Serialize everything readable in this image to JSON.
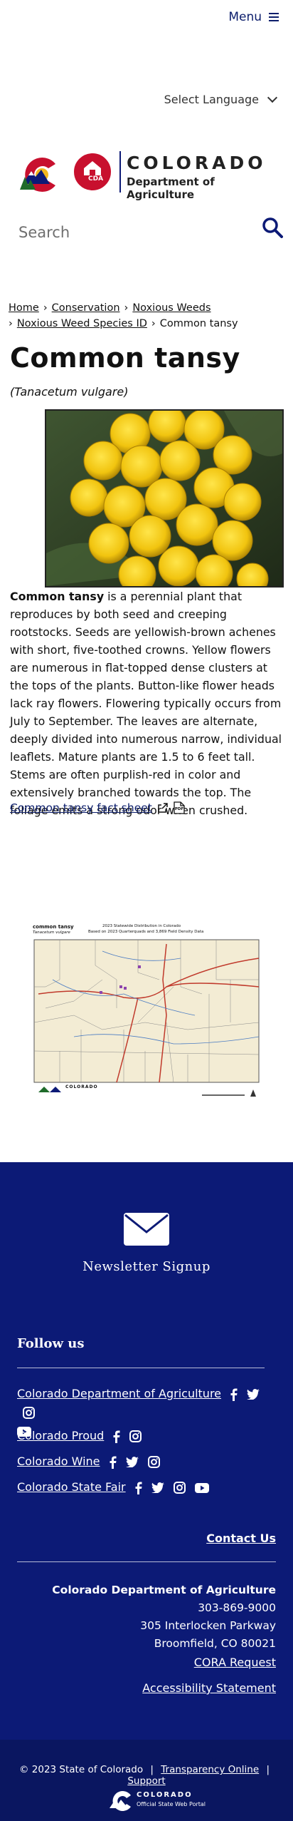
{
  "header": {
    "menu_label": "Menu",
    "language_label": "Select Language",
    "logo_line1": "COLORADO",
    "logo_line2": "Department of Agriculture",
    "logo_badge": "CDA",
    "search_placeholder": "Search"
  },
  "breadcrumb": {
    "items": [
      "Home",
      "Conservation",
      "Noxious Weeds",
      "Noxious Weed Species ID",
      "Common tansy"
    ],
    "separator": "›"
  },
  "page": {
    "title": "Common tansy",
    "scientific_name": "(Tanacetum vulgare)",
    "description_lead": "Common tansy",
    "description_rest": " is a perennial plant that reproduces by both seed and creeping rootstocks. Seeds are yellowish-brown achenes with short, five-toothed crowns. Yellow flowers are numerous in flat-topped dense clusters at the tops of the plants. Button-like flower heads lack ray flowers. Flowering typically occurs from July to September. The leaves are alternate, deeply divided into numerous narrow, individual leaflets. Mature plants are 1.5 to 6 feet tall. Stems are often purplish-red in color and extensively branched towards the top. The foliage emits a strong odor when crushed.",
    "fact_sheet_link": "Common tansy fact sheet",
    "pdf_icon_text": "PDF"
  },
  "map": {
    "title": "common tansy",
    "subtitle": "Tanacetum vulgare",
    "heading_line1": "2023 Statewide Distribution in Colorado",
    "heading_line2": "Based on 2023 Quarterquads and 3,869 Field Density Data",
    "logo_text": "COLORADO"
  },
  "footer": {
    "newsletter_label": "Newsletter Signup",
    "follow_heading": "Follow us",
    "social_rows": [
      "Colorado Department of Agriculture",
      "Colorado Proud",
      "Colorado Wine",
      "Colorado State Fair"
    ],
    "contact_label": "Contact Us",
    "org_name": "Colorado Department of Agriculture",
    "phone": "303-869-9000",
    "address1": "305 Interlocken Parkway",
    "address2": "Broomfield, CO 80021",
    "cora_link": "CORA Request",
    "accessibility_link": "Accessibility Statement",
    "copyright": "© 2023 State of Colorado",
    "transparency_link": "Transparency Online",
    "support_link": "Support",
    "portal_line1": "COLORADO",
    "portal_line2": "Official State Web Portal"
  },
  "colors": {
    "brand_navy": "#0c1a76",
    "colorado_red": "#c8102e",
    "colorado_gold": "#f2b81f"
  }
}
